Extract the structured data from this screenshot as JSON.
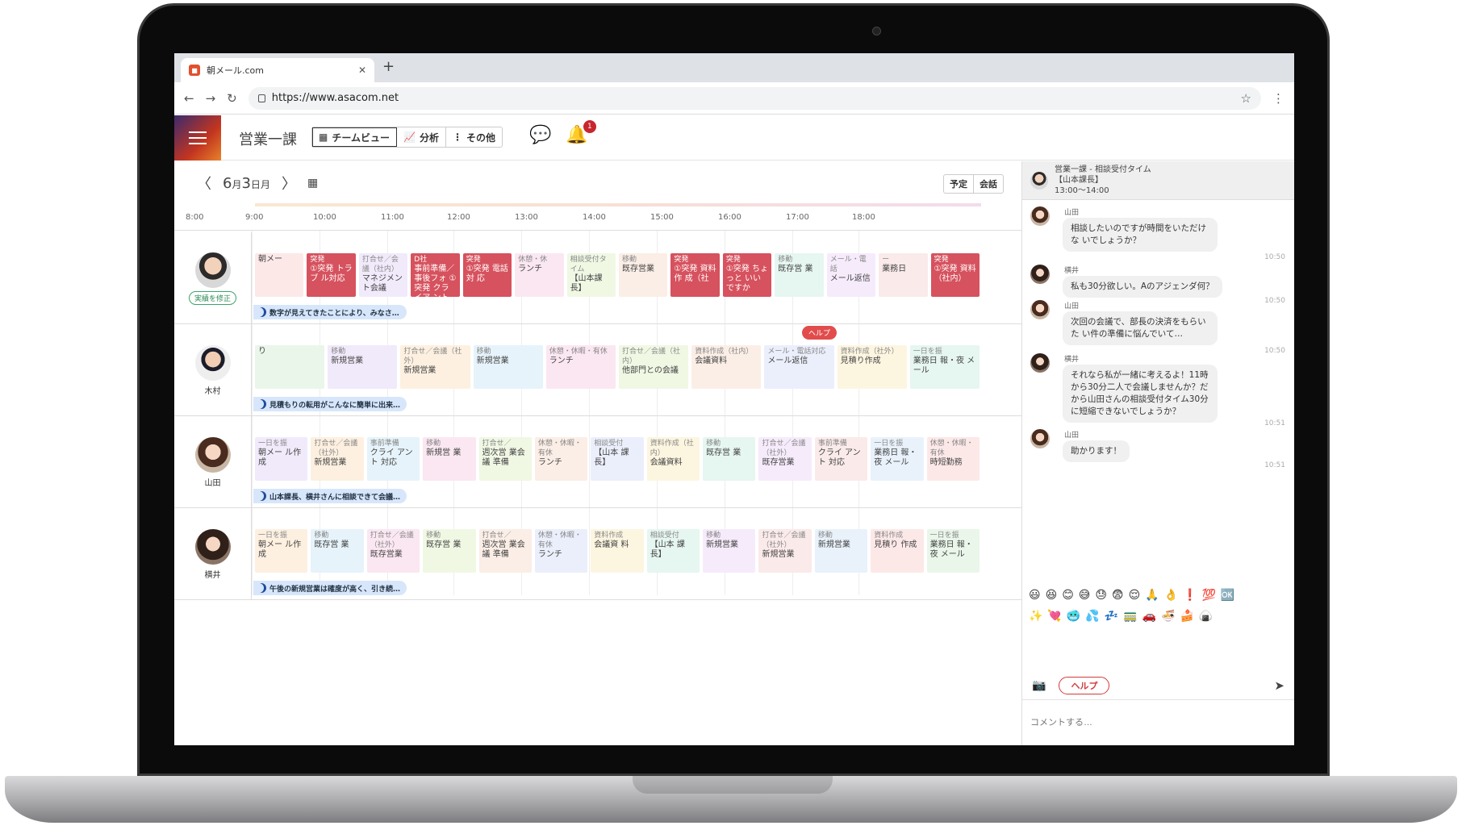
{
  "browser": {
    "tab_title": "朝メール.com",
    "url": "https://www.asacom.net"
  },
  "app": {
    "team_title": "営業一課",
    "view_tabs": [
      "チームビュー",
      "分析",
      "その他"
    ],
    "notification_count": "1",
    "date": {
      "month": "6",
      "month_suffix": "月",
      "day": "3",
      "day_suffix": "日",
      "weekday": "月"
    },
    "right_buttons": [
      "予定",
      "会話"
    ]
  },
  "timeline": {
    "ticks": [
      "8:00",
      "9:00",
      "10:00",
      "11:00",
      "12:00",
      "13:00",
      "14:00",
      "15:00",
      "16:00",
      "17:00",
      "18:00"
    ]
  },
  "members": [
    {
      "name": "",
      "edit_label": "実績を修正",
      "comment": "数字が見えてきたことにより、みなさ…",
      "blocks": [
        {
          "cat": "",
          "txt": "朝メー",
          "style": "pale"
        },
        {
          "cat": "突発",
          "txt": "①突発 トラブ ル対応",
          "style": "red"
        },
        {
          "cat": "打合せ／会議（社内）",
          "txt": "マネジメント会議",
          "style": "pale"
        },
        {
          "cat": "D社",
          "txt": "事前準備／事後フォ ①突発 クライア ント対応",
          "style": "red"
        },
        {
          "cat": "突発",
          "txt": "①突発 電話対 応",
          "style": "red"
        },
        {
          "cat": "休憩・休",
          "txt": "ランチ",
          "style": "pale"
        },
        {
          "cat": "相談受付タイム",
          "txt": "【山本課長】",
          "style": "pale"
        },
        {
          "cat": "移動",
          "txt": "既存営業",
          "style": "pale"
        },
        {
          "cat": "突発",
          "txt": "①突発 資料作 成（社",
          "style": "red"
        },
        {
          "cat": "突発",
          "txt": "①突発 ちょっと いいですか",
          "style": "red"
        },
        {
          "cat": "移動",
          "txt": "既存営 業",
          "style": "pale"
        },
        {
          "cat": "メール・電話",
          "txt": "メール返信",
          "style": "pale"
        },
        {
          "cat": "ー",
          "txt": "業務日",
          "style": "pale"
        },
        {
          "cat": "突発",
          "txt": "①突発 資料 （社内）",
          "style": "red"
        }
      ]
    },
    {
      "name": "木村",
      "comment": "見積もりの転用がこんなに簡単に出来…",
      "help_label": "ヘルプ",
      "blocks": [
        {
          "cat": "",
          "txt": "り",
          "style": "pale"
        },
        {
          "cat": "移動",
          "txt": "新規営業",
          "style": "pale"
        },
        {
          "cat": "打合せ／会議（社外）",
          "txt": "新規営業",
          "style": "pale"
        },
        {
          "cat": "移動",
          "txt": "新規営業",
          "style": "pale"
        },
        {
          "cat": "休憩・休暇・有休",
          "txt": "ランチ",
          "style": "pale"
        },
        {
          "cat": "打合せ／会議（社内）",
          "txt": "他部門との会議",
          "style": "pale"
        },
        {
          "cat": "資料作成（社内）",
          "txt": "会議資料",
          "style": "pale"
        },
        {
          "cat": "メール・電話対応",
          "txt": "メール返信",
          "style": "pale"
        },
        {
          "cat": "資料作成（社外）",
          "txt": "見積り作成",
          "style": "pale"
        },
        {
          "cat": "一日を振",
          "txt": "業務日 報・夜 メール",
          "style": "pale"
        }
      ]
    },
    {
      "name": "山田",
      "comment": "山本課長、横井さんに相談できて会議…",
      "blocks": [
        {
          "cat": "一日を振",
          "txt": "朝メー ル作成",
          "style": "pale"
        },
        {
          "cat": "打合せ／会議（社外）",
          "txt": "新規営業",
          "style": "pale"
        },
        {
          "cat": "事前準備",
          "txt": "クライ アント 対応",
          "style": "pale"
        },
        {
          "cat": "移動",
          "txt": "新規営 業",
          "style": "pale"
        },
        {
          "cat": "打合せ／",
          "txt": "週次営 業会議 準備",
          "style": "pale"
        },
        {
          "cat": "休憩・休暇・有休",
          "txt": "ランチ",
          "style": "pale"
        },
        {
          "cat": "相談受付",
          "txt": "【山本 課長】",
          "style": "pale"
        },
        {
          "cat": "資料作成（社内）",
          "txt": "会議資料",
          "style": "pale"
        },
        {
          "cat": "移動",
          "txt": "既存営 業",
          "style": "pale"
        },
        {
          "cat": "打合せ／会議（社外）",
          "txt": "既存営業",
          "style": "pale"
        },
        {
          "cat": "事前準備",
          "txt": "クライ アント 対応",
          "style": "pale"
        },
        {
          "cat": "一日を振",
          "txt": "業務日 報・夜 メール",
          "style": "pale"
        },
        {
          "cat": "休憩・休暇・有休",
          "txt": "時短勤務",
          "style": "pale"
        }
      ]
    },
    {
      "name": "横井",
      "comment": "午後の新規営業は確度が高く、引き続…",
      "blocks": [
        {
          "cat": "一日を振",
          "txt": "朝メー ル作成",
          "style": "pale"
        },
        {
          "cat": "移動",
          "txt": "既存営 業",
          "style": "pale"
        },
        {
          "cat": "打合せ／会議（社外）",
          "txt": "既存営業",
          "style": "pale"
        },
        {
          "cat": "移動",
          "txt": "既存営 業",
          "style": "pale"
        },
        {
          "cat": "打合せ／",
          "txt": "週次営 業会議 準備",
          "style": "pale"
        },
        {
          "cat": "休憩・休暇・有休",
          "txt": "ランチ",
          "style": "pale"
        },
        {
          "cat": "資料作成",
          "txt": "会議資 料",
          "style": "pale"
        },
        {
          "cat": "相談受付",
          "txt": "【山本 課長】",
          "style": "pale"
        },
        {
          "cat": "移動",
          "txt": "新規営業",
          "style": "pale"
        },
        {
          "cat": "打合せ／会議（社外）",
          "txt": "新規営業",
          "style": "pale"
        },
        {
          "cat": "移動",
          "txt": "新規営業",
          "style": "pale"
        },
        {
          "cat": "資料作成",
          "txt": "見積り 作成",
          "style": "pale"
        },
        {
          "cat": "一日を振",
          "txt": "業務日 報・夜 メール",
          "style": "pale"
        }
      ]
    }
  ],
  "chat": {
    "header_line1": "営業一課 - 相談受付タイム",
    "header_line2": "【山本課長】",
    "header_line3": "13:00〜14:00",
    "messages": [
      {
        "who": "山田",
        "text": "相談したいのですが時間をいただけな いでしょうか？",
        "time": "10:50"
      },
      {
        "who": "横井",
        "text": "私も30分欲しい。Aのアジェンダ何？",
        "time": "10:50"
      },
      {
        "who": "山田",
        "text": "次回の会議で、部長の決済をもらいた い件の準備に悩んでいて…",
        "time": "10:50"
      },
      {
        "who": "横井",
        "text": "それなら私が一緒に考えるよ！11時 から30分二人で会議しませんか？だ から山田さんの相談受付タイム30分 に短縮できないでしょうか？",
        "time": "10:51"
      },
      {
        "who": "山田",
        "text": "助かります！",
        "time": "10:51"
      }
    ],
    "emoji_row1": "😃😆😊😅😓😨😌🙏👌❗💯🆗",
    "emoji_row2": "✨💘🥶💦💤🚃🚗🍜🍰🍙",
    "help_button": "ヘルプ",
    "comment_placeholder": "コメントする…"
  }
}
